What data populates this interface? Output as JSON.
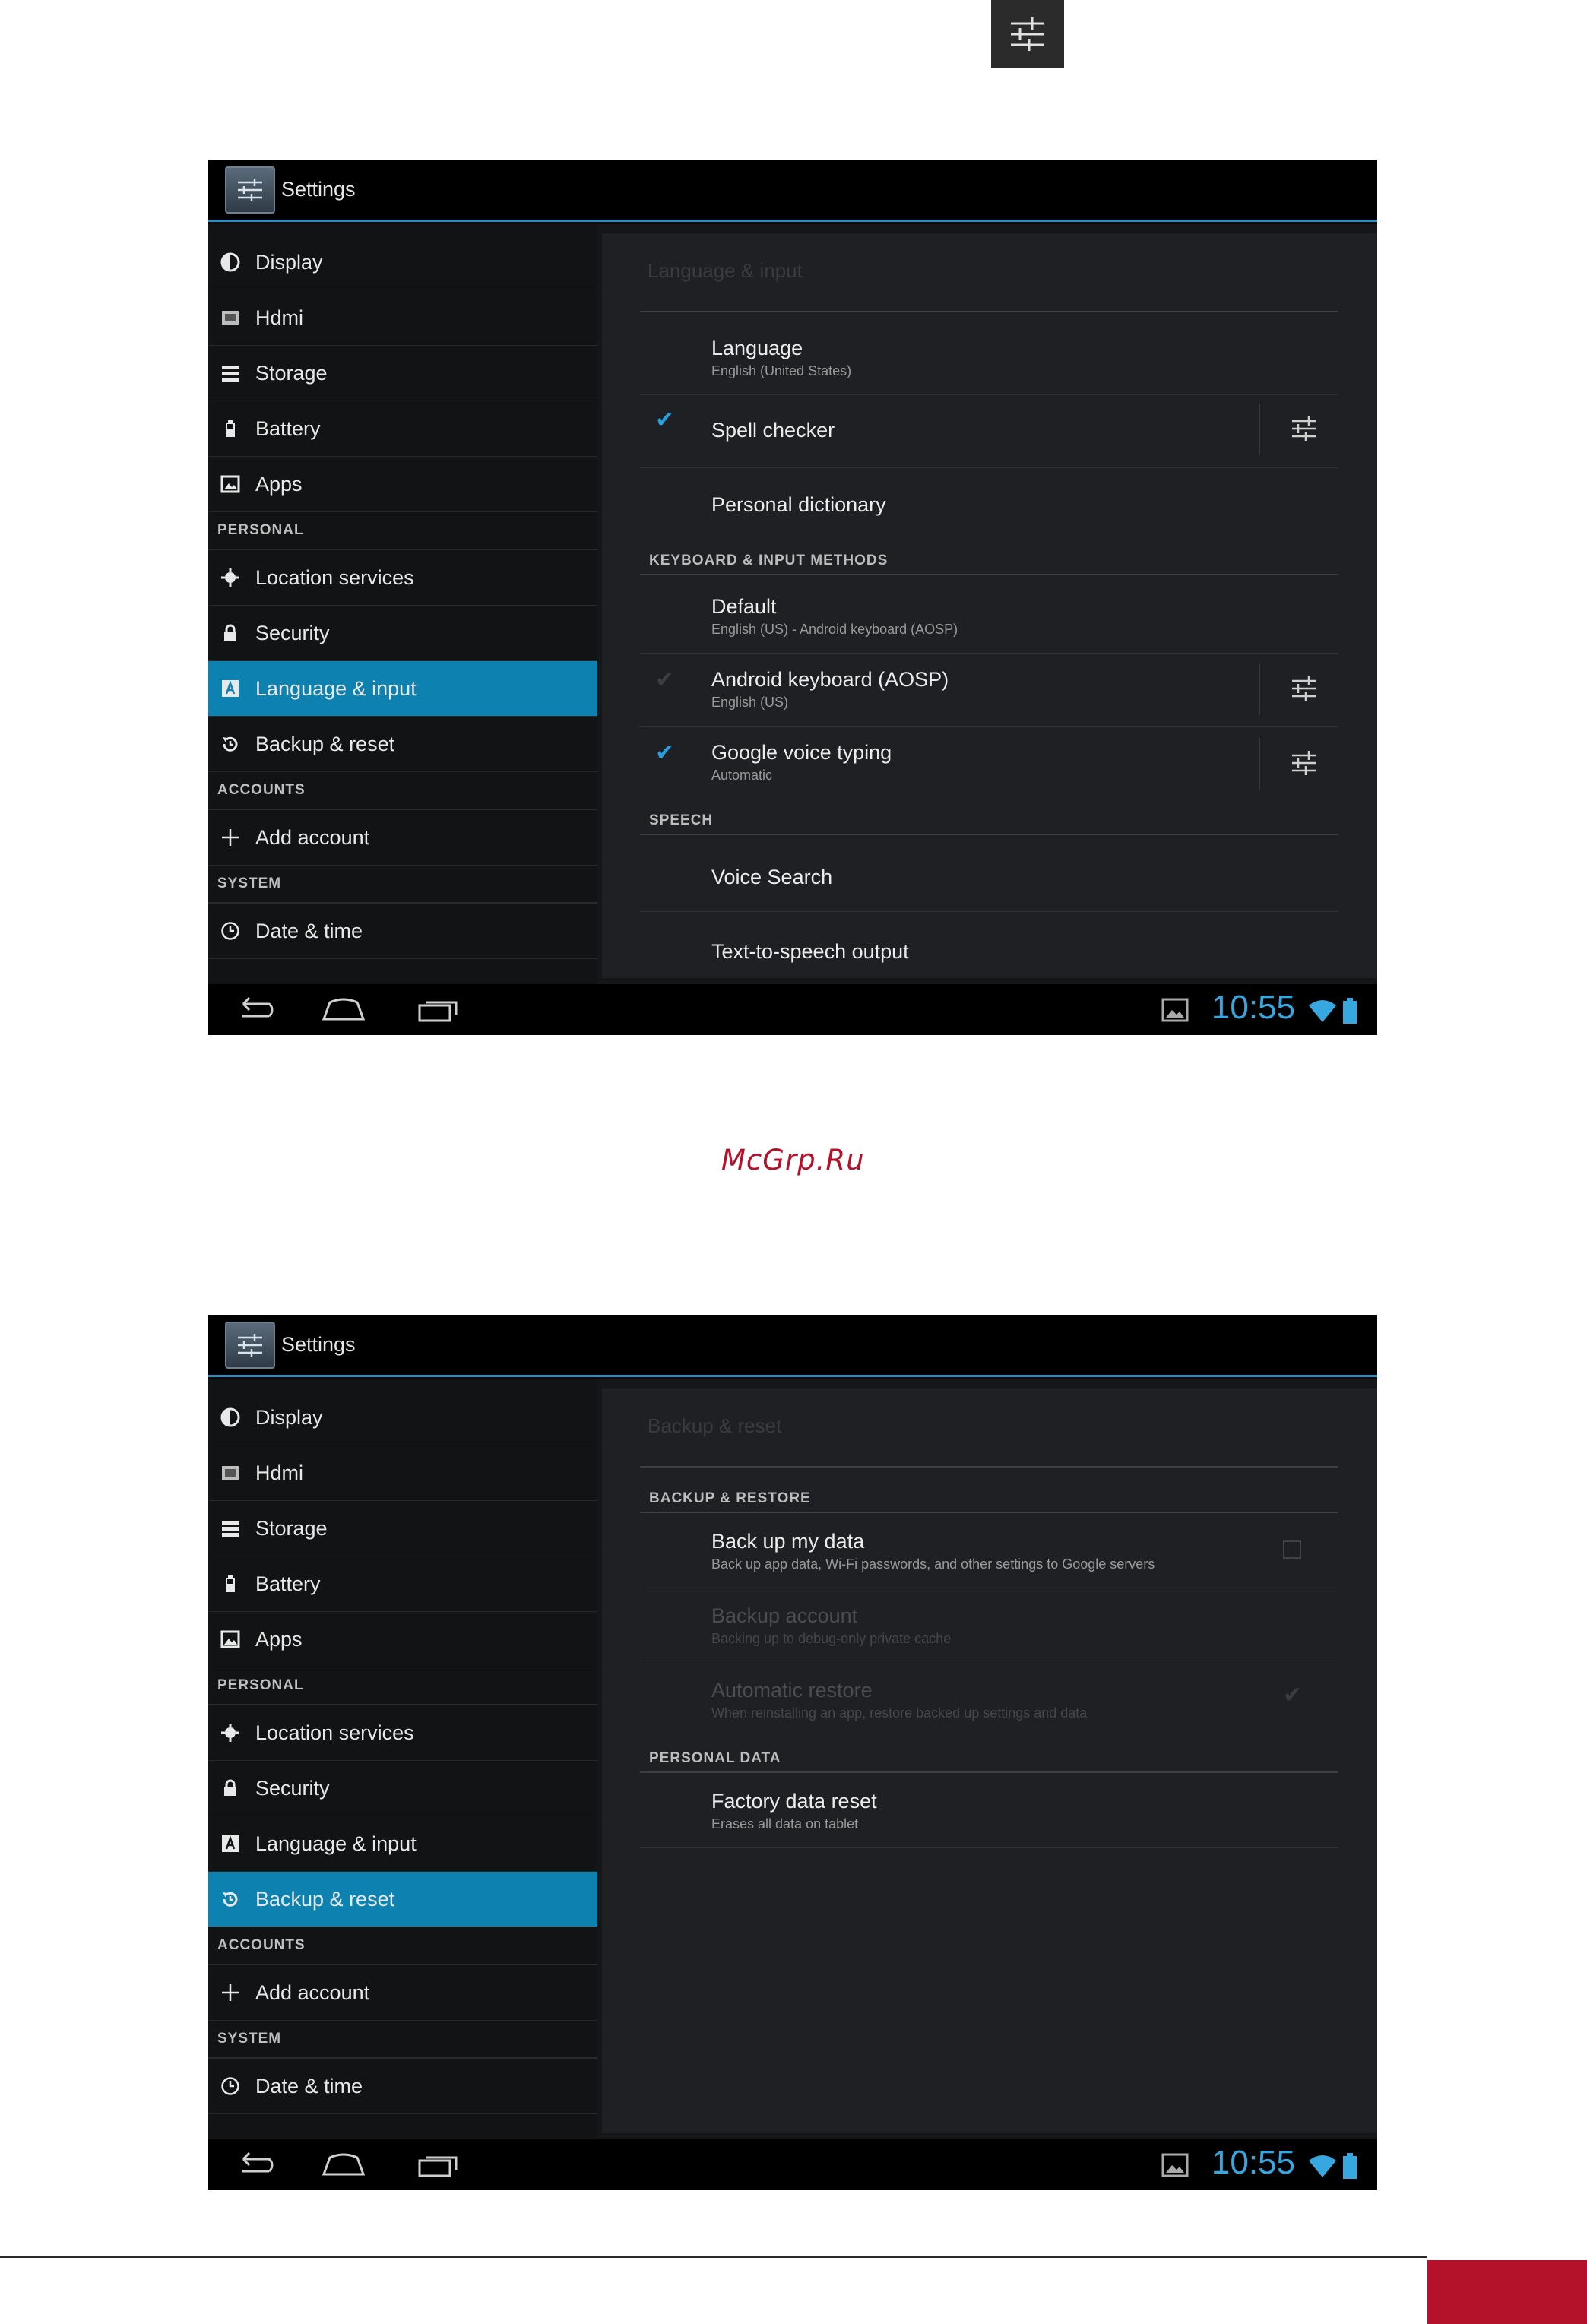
{
  "watermark": "McGrp.Ru",
  "icons": {
    "page_top": "sliders-icon",
    "nav": [
      "back-icon",
      "home-icon",
      "recents-icon"
    ],
    "status": [
      "gallery-icon",
      "wifi-icon",
      "battery-icon"
    ]
  },
  "colors": {
    "accent": "#0d82b0",
    "clock": "#36a7df",
    "check": "#2a9ed8",
    "brand_red": "#b4122a"
  },
  "shot1": {
    "app_title": "Settings",
    "sidebar": {
      "items": [
        {
          "label": "Display",
          "icon": "display-icon"
        },
        {
          "label": "Hdmi",
          "icon": "hdmi-icon"
        },
        {
          "label": "Storage",
          "icon": "storage-icon"
        },
        {
          "label": "Battery",
          "icon": "battery-icon"
        },
        {
          "label": "Apps",
          "icon": "apps-icon"
        }
      ],
      "personal_header": "PERSONAL",
      "personal": [
        {
          "label": "Location services",
          "icon": "location-icon"
        },
        {
          "label": "Security",
          "icon": "lock-icon"
        },
        {
          "label": "Language & input",
          "icon": "language-icon",
          "active": true
        },
        {
          "label": "Backup & reset",
          "icon": "backup-icon"
        }
      ],
      "accounts_header": "ACCOUNTS",
      "accounts": [
        {
          "label": "Add account",
          "icon": "plus-icon"
        }
      ],
      "system_header": "SYSTEM",
      "system": [
        {
          "label": "Date & time",
          "icon": "clock-icon"
        }
      ]
    },
    "pane": {
      "title": "Language & input",
      "language": {
        "title": "Language",
        "summary": "English (United States)"
      },
      "spell_checker": {
        "title": "Spell checker",
        "checked": true
      },
      "personal_dictionary": {
        "title": "Personal dictionary"
      },
      "keyboard_header": "KEYBOARD & INPUT METHODS",
      "default": {
        "title": "Default",
        "summary": "English (US) - Android keyboard (AOSP)"
      },
      "android_keyboard": {
        "title": "Android keyboard (AOSP)",
        "summary": "English (US)",
        "checked": true
      },
      "google_voice": {
        "title": "Google voice typing",
        "summary": "Automatic",
        "checked": true
      },
      "speech_header": "SPEECH",
      "voice_search": {
        "title": "Voice Search"
      },
      "tts": {
        "title": "Text-to-speech output"
      }
    },
    "clock": "10:55"
  },
  "shot2": {
    "app_title": "Settings",
    "sidebar": {
      "items": [
        {
          "label": "Display"
        },
        {
          "label": "Hdmi"
        },
        {
          "label": "Storage"
        },
        {
          "label": "Battery"
        },
        {
          "label": "Apps"
        }
      ],
      "personal_header": "PERSONAL",
      "personal": [
        {
          "label": "Location services"
        },
        {
          "label": "Security"
        },
        {
          "label": "Language & input"
        },
        {
          "label": "Backup & reset",
          "active": true
        }
      ],
      "accounts_header": "ACCOUNTS",
      "accounts": [
        {
          "label": "Add account"
        }
      ],
      "system_header": "SYSTEM",
      "system": [
        {
          "label": "Date & time"
        }
      ]
    },
    "pane": {
      "title": "Backup & reset",
      "backup_header": "BACKUP & RESTORE",
      "backup_data": {
        "title": "Back up my data",
        "summary": "Back up app data, Wi-Fi passwords, and other settings to Google servers",
        "checked": false
      },
      "backup_account": {
        "title": "Backup account",
        "summary": "Backing up to debug-only private cache"
      },
      "auto_restore": {
        "title": "Automatic restore",
        "summary": "When reinstalling an app, restore backed up settings and data",
        "checked": true
      },
      "personal_header": "PERSONAL DATA",
      "factory_reset": {
        "title": "Factory data reset",
        "summary": "Erases all data on tablet"
      }
    },
    "clock": "10:55"
  }
}
